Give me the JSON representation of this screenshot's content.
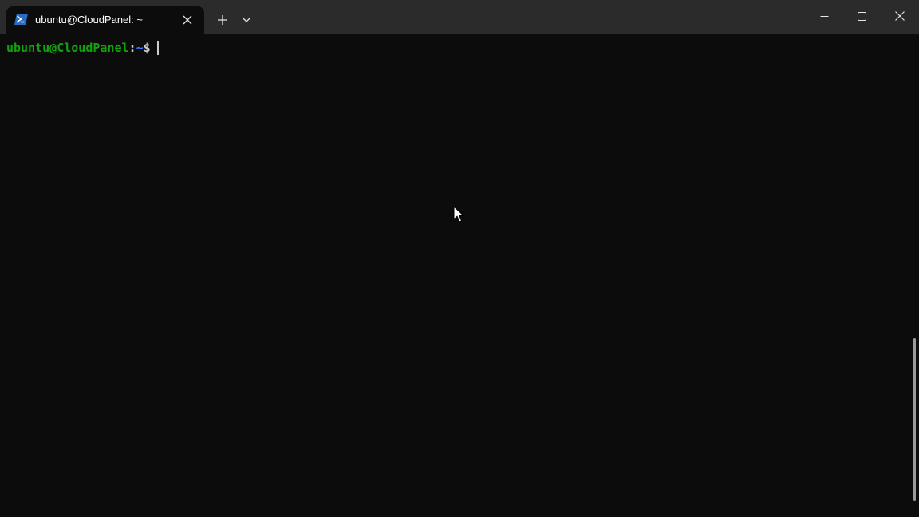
{
  "tab": {
    "title": "ubuntu@CloudPanel: ~",
    "icon": "powershell-icon",
    "close_icon": "close-icon"
  },
  "tabbar": {
    "new_tab_icon": "plus-icon",
    "dropdown_icon": "chevron-down-icon"
  },
  "window_controls": {
    "minimize_icon": "minimize-icon",
    "maximize_icon": "maximize-icon",
    "close_icon": "close-icon"
  },
  "terminal": {
    "prompt_user_host": "ubuntu@CloudPanel",
    "prompt_separator": ":",
    "prompt_path": "~",
    "prompt_symbol": "$",
    "input": ""
  },
  "colors": {
    "background": "#0c0c0c",
    "titlebar": "#2b2b2b",
    "prompt_user": "#13a10e",
    "prompt_path": "#3b78ff",
    "text": "#cccccc"
  }
}
